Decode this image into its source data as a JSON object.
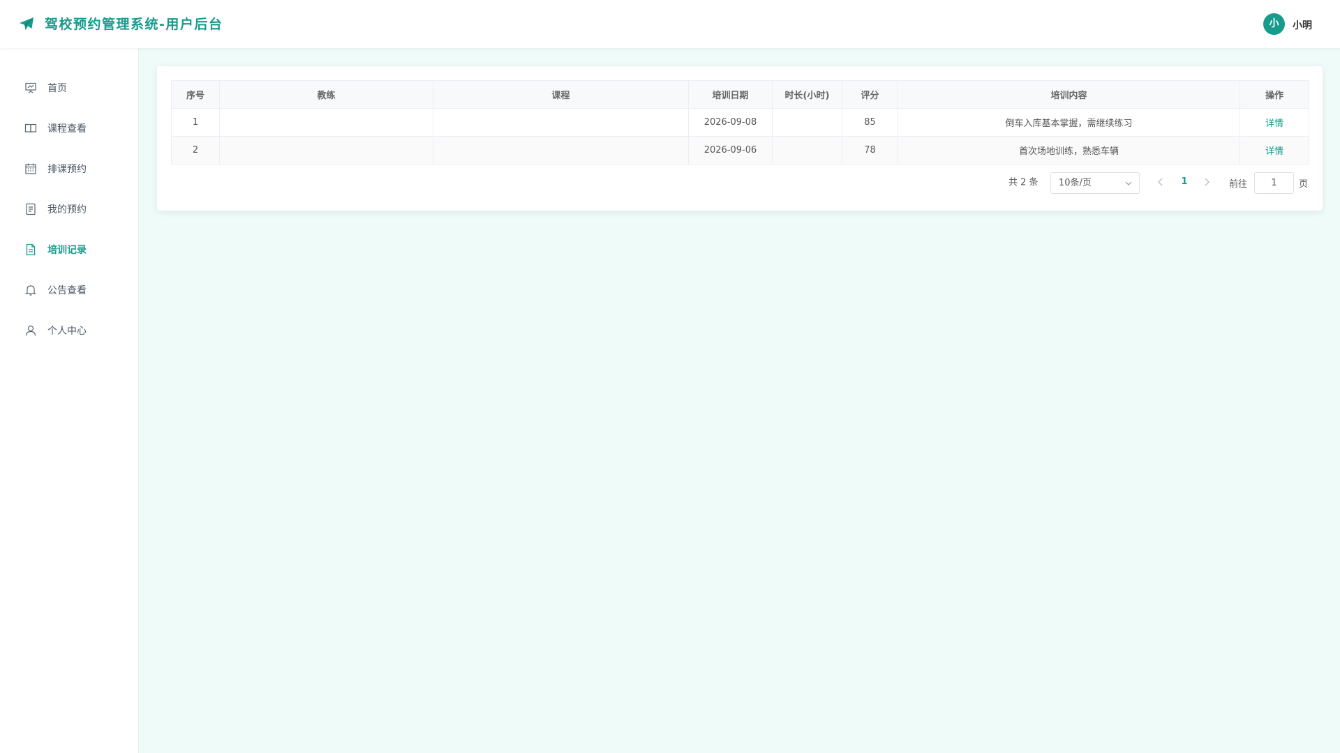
{
  "header": {
    "title": "驾校预约管理系统-用户后台",
    "avatar_text": "小",
    "username": "小明",
    "accent_color": "#169b8c"
  },
  "sidebar": {
    "items": [
      {
        "label": "首页",
        "icon": "presentation-icon",
        "active": false
      },
      {
        "label": "课程查看",
        "icon": "book-icon",
        "active": false
      },
      {
        "label": "排课预约",
        "icon": "calendar-icon",
        "active": false
      },
      {
        "label": "我的预约",
        "icon": "document-list-icon",
        "active": false
      },
      {
        "label": "培训记录",
        "icon": "document-icon",
        "active": true
      },
      {
        "label": "公告查看",
        "icon": "bell-icon",
        "active": false
      },
      {
        "label": "个人中心",
        "icon": "user-icon",
        "active": false
      }
    ]
  },
  "table": {
    "columns": [
      "序号",
      "教练",
      "课程",
      "培训日期",
      "时长(小时)",
      "评分",
      "培训内容",
      "操作"
    ],
    "rows": [
      {
        "index": "1",
        "coach": "",
        "course": "",
        "date": "2026-09-08",
        "duration": "",
        "score": "85",
        "content": "倒车入库基本掌握，需继续练习",
        "action": "详情"
      },
      {
        "index": "2",
        "coach": "",
        "course": "",
        "date": "2026-09-06",
        "duration": "",
        "score": "78",
        "content": "首次场地训练，熟悉车辆",
        "action": "详情"
      }
    ]
  },
  "pagination": {
    "total_text": "共 2 条",
    "page_size": "10条/页",
    "current_page": "1",
    "goto_label": "前往",
    "goto_value": "1",
    "page_suffix": "页"
  }
}
